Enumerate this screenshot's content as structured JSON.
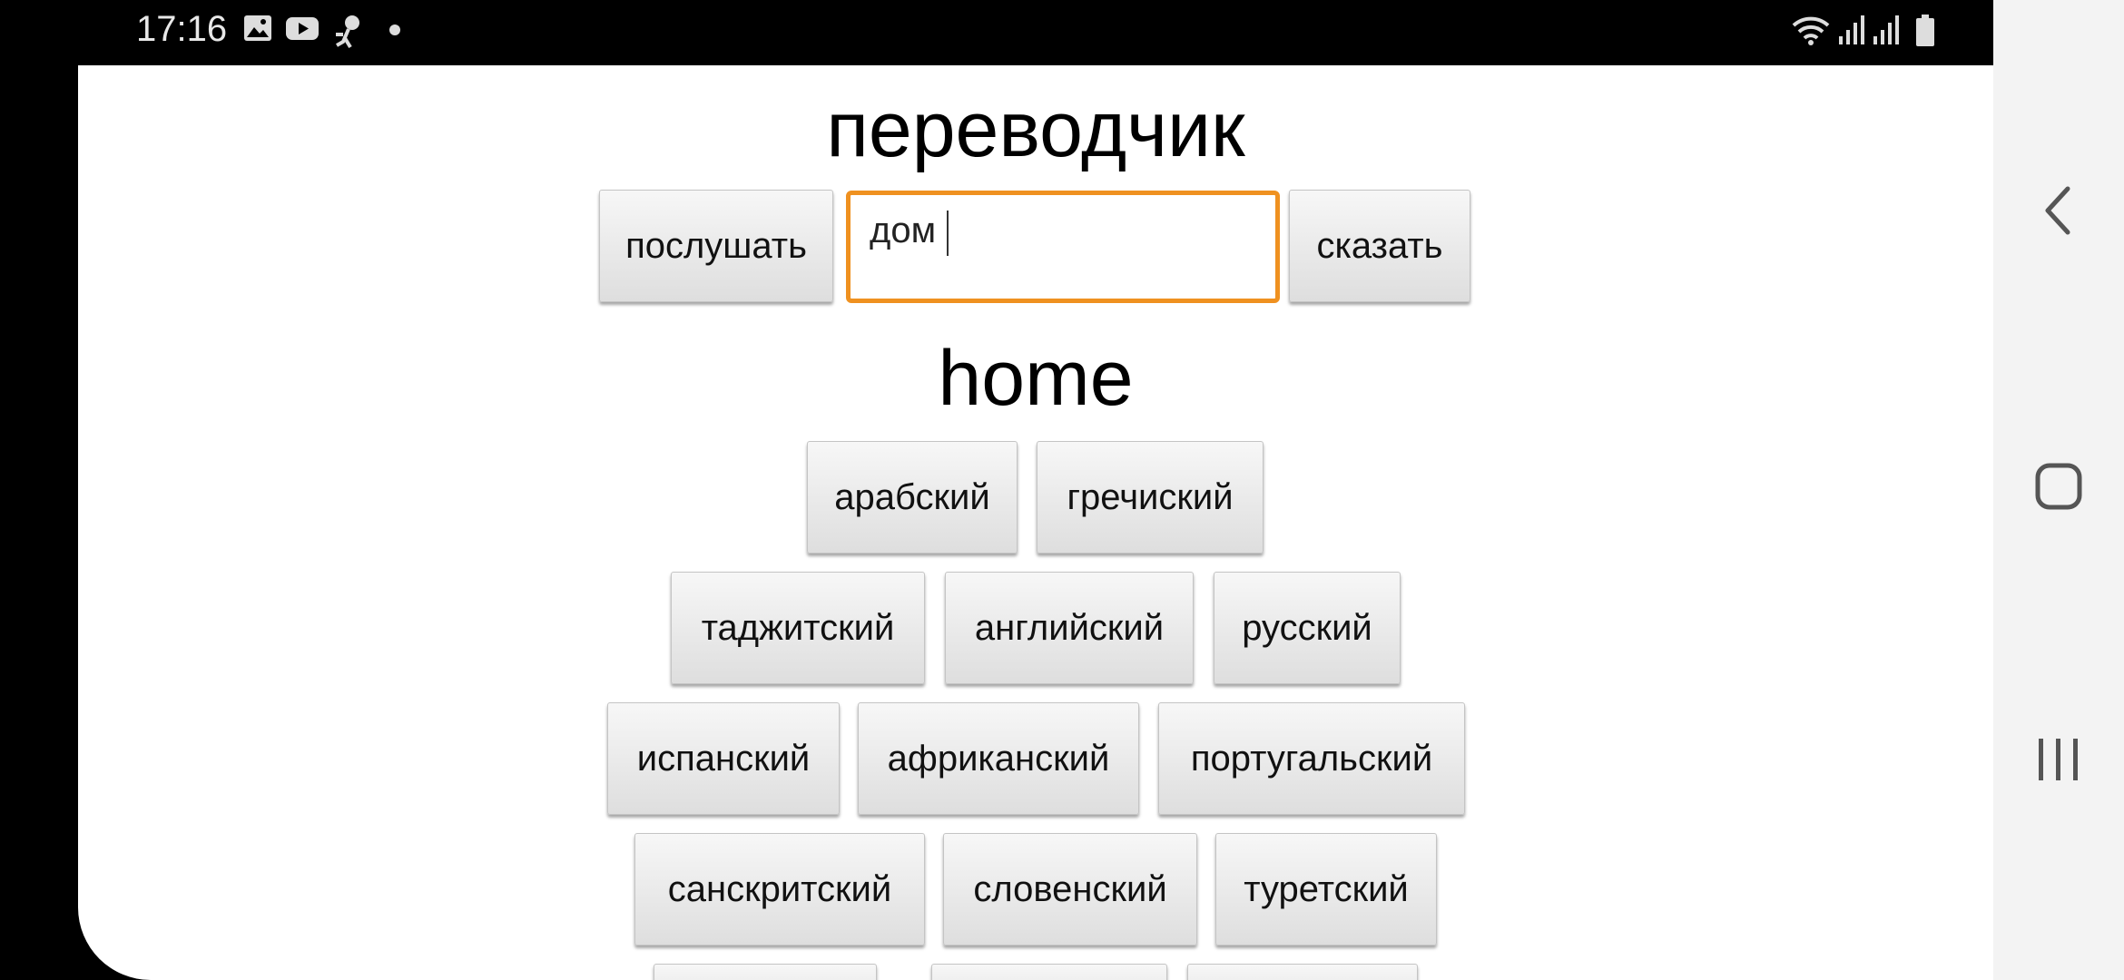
{
  "status_bar": {
    "time": "17:16",
    "left_icons": [
      "image-icon",
      "youtube-icon",
      "runner-icon",
      "dot-icon"
    ],
    "right_icons": [
      "wifi-icon",
      "signal-icon",
      "signal-icon",
      "battery-icon"
    ]
  },
  "app": {
    "title": "переводчик",
    "listen_label": "послушать",
    "speak_label": "сказать",
    "input_value": "дом",
    "result": "home",
    "accent_color": "#ef9120"
  },
  "languages": [
    [
      "арабский",
      "гречиский"
    ],
    [
      "таджитский",
      "английский",
      "русский"
    ],
    [
      "испанский",
      "африканский",
      "португальский"
    ],
    [
      "санскритский",
      "словенский",
      "туретский"
    ]
  ],
  "nav_bar": {
    "buttons": [
      "back-icon",
      "home-icon",
      "recents-icon"
    ]
  }
}
